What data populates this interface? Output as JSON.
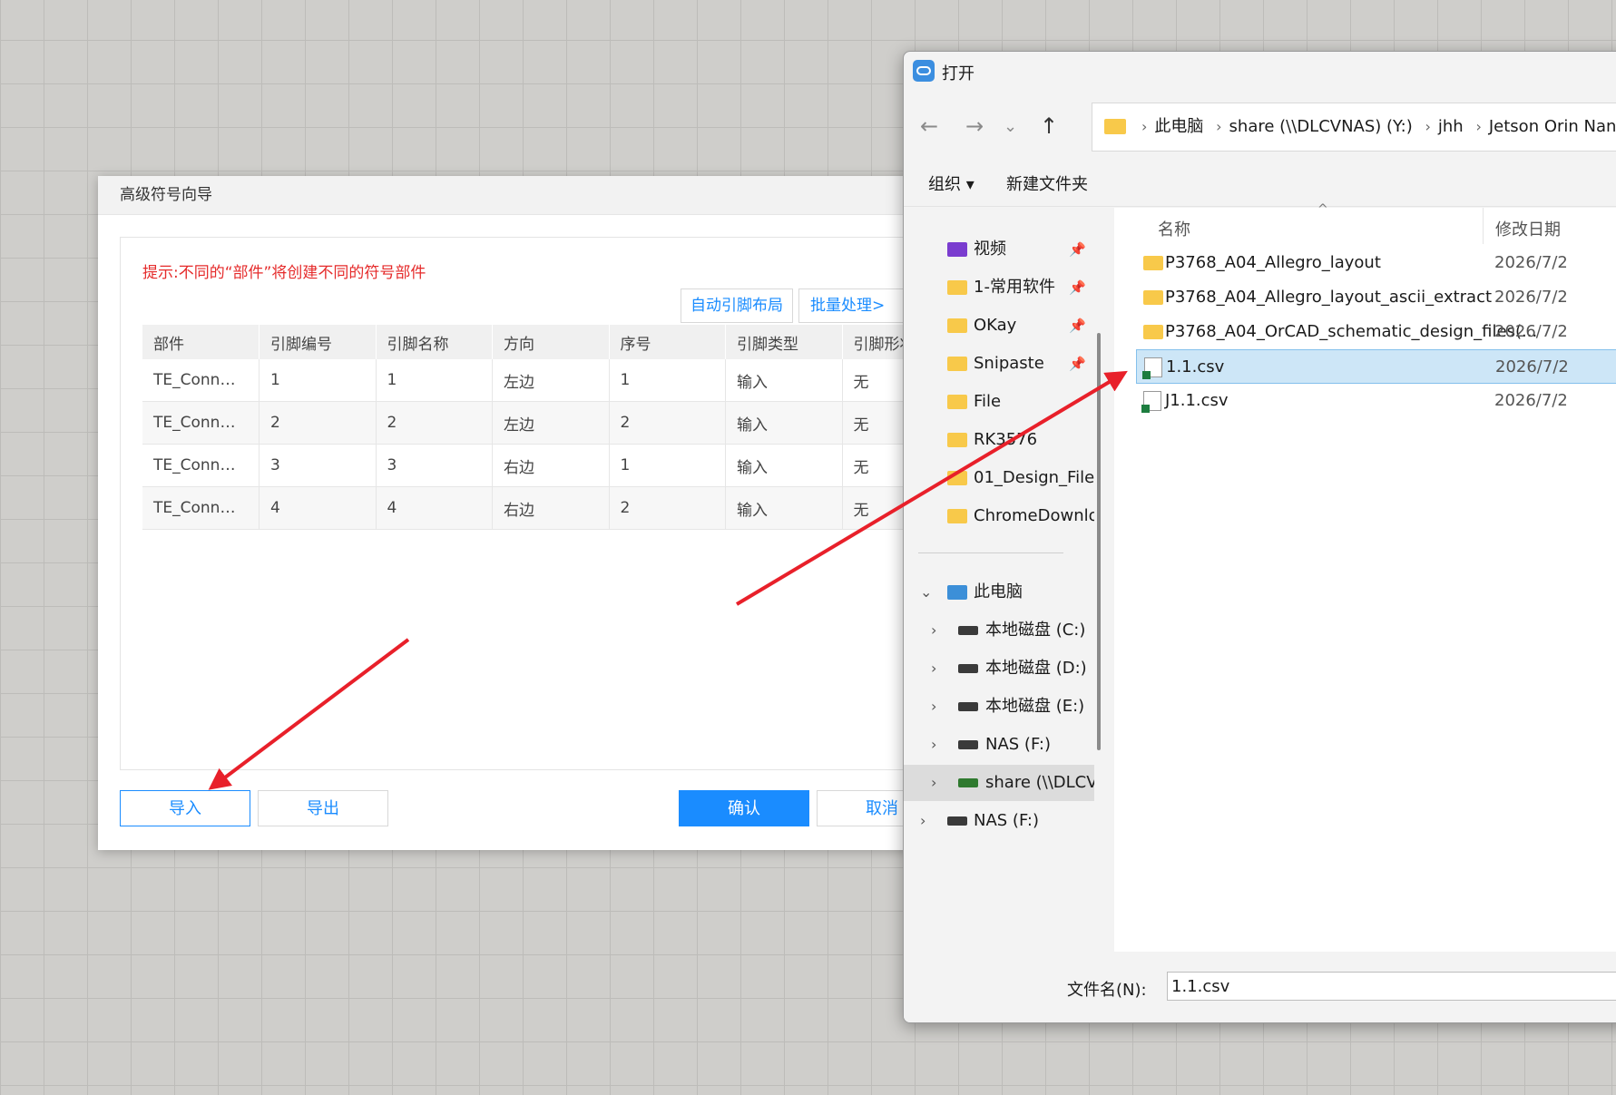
{
  "wizard": {
    "title": "高级符号向导",
    "hint": "提示:不同的“部件”将创建不同的符号部件",
    "toolbar": {
      "auto_layout": "自动引脚布局",
      "batch": "批量处理>"
    },
    "columns": [
      "部件",
      "引脚编号",
      "引脚名称",
      "方向",
      "序号",
      "引脚类型",
      "引脚形状"
    ],
    "rows": [
      [
        "TE_Conn…",
        "1",
        "1",
        "左边",
        "1",
        "输入",
        "无"
      ],
      [
        "TE_Conn…",
        "2",
        "2",
        "左边",
        "2",
        "输入",
        "无"
      ],
      [
        "TE_Conn…",
        "3",
        "3",
        "右边",
        "1",
        "输入",
        "无"
      ],
      [
        "TE_Conn…",
        "4",
        "4",
        "右边",
        "2",
        "输入",
        "无"
      ]
    ],
    "buttons": {
      "import": "导入",
      "export": "导出",
      "confirm": "确认",
      "cancel": "取消"
    }
  },
  "file_dialog": {
    "title": "打开",
    "breadcrumbs": [
      "此电脑",
      "share (\\\\DLCVNAS) (Y:)",
      "jhh",
      "Jetson Orin Nano"
    ],
    "commands": {
      "organize": "组织 ▾",
      "new_folder": "新建文件夹"
    },
    "quick_access": [
      {
        "label": "视频",
        "pinned": true
      },
      {
        "label": "1-常用软件",
        "pinned": true
      },
      {
        "label": "OKay",
        "pinned": true
      },
      {
        "label": "Snipaste",
        "pinned": true
      },
      {
        "label": "File",
        "pinned": false
      },
      {
        "label": "RK3576",
        "pinned": false
      },
      {
        "label": "01_Design_File",
        "pinned": false
      },
      {
        "label": "ChromeDownlo",
        "pinned": false
      }
    ],
    "this_pc": "此电脑",
    "drives": [
      "本地磁盘 (C:)",
      "本地磁盘 (D:)",
      "本地磁盘 (E:)",
      "NAS (F:)",
      "share (\\\\DLCV"
    ],
    "network": "NAS (F:)",
    "columns": {
      "name": "名称",
      "modified": "修改日期"
    },
    "files": [
      {
        "name": "P3768_A04_Allegro_layout",
        "date": "2026/7/2",
        "type": "folder"
      },
      {
        "name": "P3768_A04_Allegro_layout_ascii_extract",
        "date": "2026/7/2",
        "type": "folder"
      },
      {
        "name": "P3768_A04_OrCAD_schematic_design_files(...",
        "date": "2026/7/2",
        "type": "folder"
      },
      {
        "name": "1.1.csv",
        "date": "2026/7/2",
        "type": "csv",
        "selected": true
      },
      {
        "name": "J1.1.csv",
        "date": "2026/7/2",
        "type": "csv"
      }
    ],
    "filename_label": "文件名(N):",
    "filename_value": "1.1.csv"
  },
  "colors": {
    "accent": "#1a8cff",
    "hint_red": "#e52b2b",
    "arrow_red": "#e8202a"
  }
}
